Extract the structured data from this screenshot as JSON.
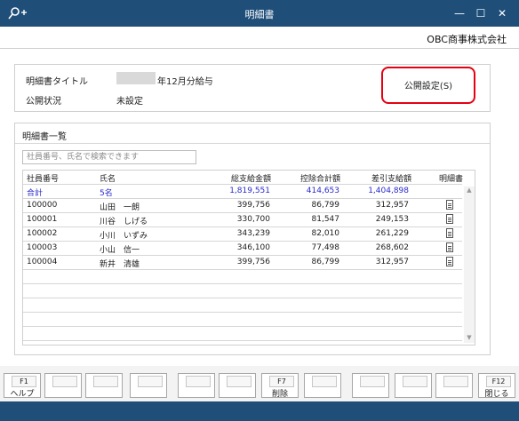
{
  "window": {
    "title": "明細書"
  },
  "company": "OBC商事株式会社",
  "info": {
    "title_label": "明細書タイトル",
    "title_value": "年12月分給与",
    "status_label": "公開状況",
    "status_value": "未設定",
    "publish_button": "公開設定(S)"
  },
  "list": {
    "heading": "明細書一覧",
    "search_placeholder": "社員番号、氏名で検索できます",
    "columns": [
      "社員番号",
      "氏名",
      "総支給金額",
      "控除合計額",
      "差引支給額",
      "明細書"
    ],
    "total": {
      "id": "合計",
      "name": "5名",
      "gross": "1,819,551",
      "deduction": "414,653",
      "net": "1,404,898"
    },
    "rows": [
      {
        "id": "100000",
        "name": "山田　一朗",
        "gross": "399,756",
        "deduction": "86,799",
        "net": "312,957"
      },
      {
        "id": "100001",
        "name": "川谷　しげる",
        "gross": "330,700",
        "deduction": "81,547",
        "net": "249,153"
      },
      {
        "id": "100002",
        "name": "小川　いずみ",
        "gross": "343,239",
        "deduction": "82,010",
        "net": "261,229"
      },
      {
        "id": "100003",
        "name": "小山　信一",
        "gross": "346,100",
        "deduction": "77,498",
        "net": "268,602"
      },
      {
        "id": "100004",
        "name": "新井　清雄",
        "gross": "399,756",
        "deduction": "86,799",
        "net": "312,957"
      }
    ]
  },
  "fkeys": {
    "f1": {
      "key": "F1",
      "label": "ヘルプ"
    },
    "f7": {
      "key": "F7",
      "label": "削除"
    },
    "f12": {
      "key": "F12",
      "label": "閉じる"
    }
  }
}
